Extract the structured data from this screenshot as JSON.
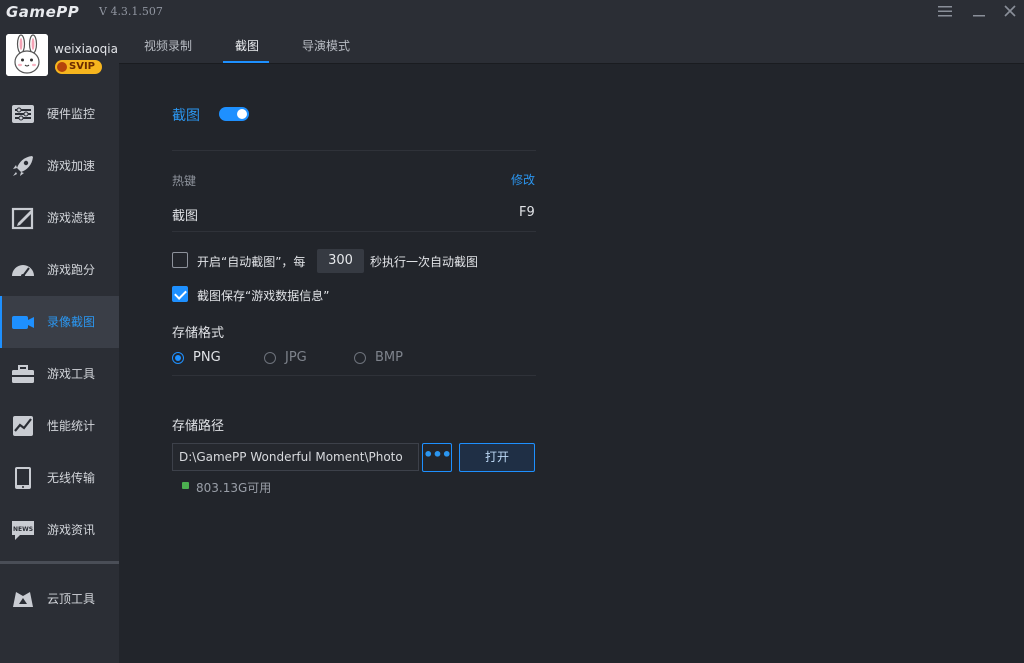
{
  "app": {
    "logo": "GamePP",
    "version": "V 4.3.1.507"
  },
  "user": {
    "name": "weixiaoqia..",
    "badge": "SVIP"
  },
  "sidebar": {
    "items": [
      {
        "label": "硬件监控",
        "icon": "hardware-monitor-icon",
        "active": false
      },
      {
        "label": "游戏加速",
        "icon": "rocket-icon",
        "active": false
      },
      {
        "label": "游戏滤镜",
        "icon": "filter-icon",
        "active": false
      },
      {
        "label": "游戏跑分",
        "icon": "speedometer-icon",
        "active": false
      },
      {
        "label": "录像截图",
        "icon": "video-camera-icon",
        "active": true
      },
      {
        "label": "游戏工具",
        "icon": "toolbox-icon",
        "active": false
      },
      {
        "label": "性能统计",
        "icon": "stats-chart-icon",
        "active": false
      },
      {
        "label": "无线传输",
        "icon": "tablet-icon",
        "active": false
      },
      {
        "label": "游戏资讯",
        "icon": "news-icon",
        "active": false
      }
    ],
    "cloud": {
      "label": "云顶工具",
      "icon": "cloud-tool-icon"
    }
  },
  "tabs": [
    {
      "label": "视频录制",
      "active": false
    },
    {
      "label": "截图",
      "active": true
    },
    {
      "label": "导演模式",
      "active": false
    }
  ],
  "screenshot": {
    "title": "截图",
    "enabled": true,
    "hotkey_section": "热键",
    "modify_link": "修改",
    "hotkey_name": "截图",
    "hotkey_value": "F9",
    "auto_capture": {
      "checked": false,
      "prefix": "开启“自动截图”，每",
      "seconds": "300",
      "suffix": "秒执行一次自动截图"
    },
    "save_info": {
      "checked": true,
      "label": "截图保存“游戏数据信息”"
    },
    "format_label": "存储格式",
    "formats": [
      {
        "label": "PNG",
        "selected": true
      },
      {
        "label": "JPG",
        "selected": false
      },
      {
        "label": "BMP",
        "selected": false
      }
    ],
    "path_label": "存储路径",
    "path_value": "D:\\GamePP Wonderful Moment\\Photo",
    "browse_label": "•••",
    "open_label": "打开",
    "free_space": "803.13G可用"
  },
  "colors": {
    "accent": "#1e90ff",
    "background": "#22252b",
    "sidebar": "#2b2e35"
  }
}
